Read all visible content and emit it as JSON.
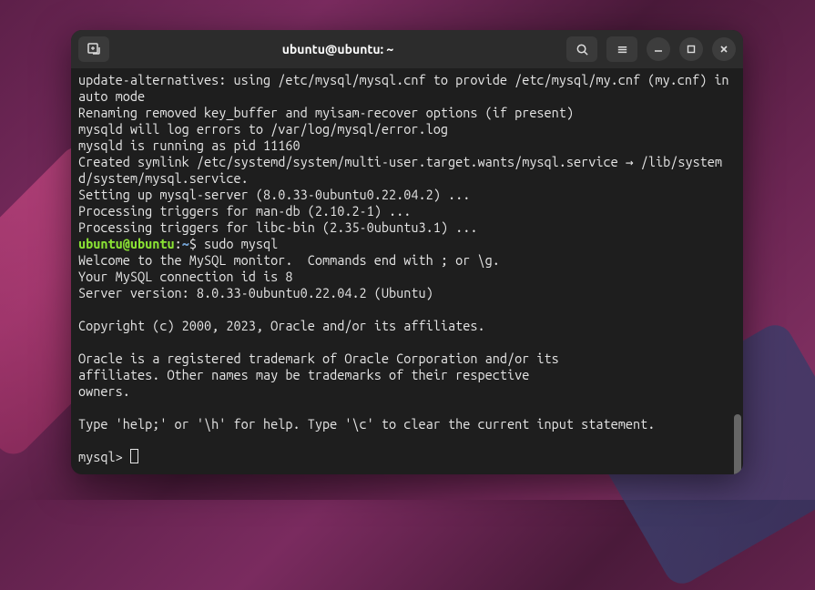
{
  "titlebar": {
    "title": "ubuntu@ubuntu: ~"
  },
  "prompt": {
    "user_host": "ubuntu@ubuntu",
    "path": "~",
    "sep": ":",
    "dollar": "$",
    "command": " sudo mysql"
  },
  "output": {
    "line1": "update-alternatives: using /etc/mysql/mysql.cnf to provide /etc/mysql/my.cnf (my.cnf) in auto mode",
    "line2": "Renaming removed key_buffer and myisam-recover options (if present)",
    "line3": "mysqld will log errors to /var/log/mysql/error.log",
    "line4": "mysqld is running as pid 11160",
    "line5": "Created symlink /etc/systemd/system/multi-user.target.wants/mysql.service → /lib/systemd/system/mysql.service.",
    "line6": "Setting up mysql-server (8.0.33-0ubuntu0.22.04.2) ...",
    "line7": "Processing triggers for man-db (2.10.2-1) ...",
    "line8": "Processing triggers for libc-bin (2.35-0ubuntu3.1) ...",
    "welcome": "Welcome to the MySQL monitor.  Commands end with ; or \\g.",
    "conn": "Your MySQL connection id is 8",
    "version": "Server version: 8.0.33-0ubuntu0.22.04.2 (Ubuntu)",
    "copyright": "Copyright (c) 2000, 2023, Oracle and/or its affiliates.",
    "trademark1": "Oracle is a registered trademark of Oracle Corporation and/or its",
    "trademark2": "affiliates. Other names may be trademarks of their respective",
    "trademark3": "owners.",
    "help": "Type 'help;' or '\\h' for help. Type '\\c' to clear the current input statement.",
    "mysql_prompt": "mysql> "
  }
}
